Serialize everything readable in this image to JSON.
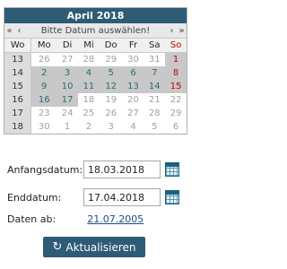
{
  "calendar": {
    "title": "April  2018",
    "nav": {
      "prev_year": "«",
      "prev_month": "‹",
      "message": "Bitte Datum auswählen!",
      "next_month": "›",
      "next_year": "»"
    },
    "weekday_headers": [
      "Wo",
      "Mo",
      "Di",
      "Mi",
      "Do",
      "Fr",
      "Sa",
      "So"
    ],
    "weeks": [
      {
        "wk": "13",
        "days": [
          "26",
          "27",
          "28",
          "29",
          "30",
          "31",
          "1"
        ]
      },
      {
        "wk": "14",
        "days": [
          "2",
          "3",
          "4",
          "5",
          "6",
          "7",
          "8"
        ]
      },
      {
        "wk": "15",
        "days": [
          "9",
          "10",
          "11",
          "12",
          "13",
          "14",
          "15"
        ]
      },
      {
        "wk": "16",
        "days": [
          "16",
          "17",
          "18",
          "19",
          "20",
          "21",
          "22"
        ]
      },
      {
        "wk": "17",
        "days": [
          "23",
          "24",
          "25",
          "26",
          "27",
          "28",
          "29"
        ]
      },
      {
        "wk": "18",
        "days": [
          "30",
          "1",
          "2",
          "3",
          "4",
          "5",
          "6"
        ]
      }
    ]
  },
  "form": {
    "start_label": "Anfangsdatum:",
    "start_value": "18.03.2018",
    "end_label": "Enddatum:",
    "end_value": "17.04.2018",
    "data_label": "Daten ab:",
    "data_link": "21.07.2005"
  },
  "refresh_button": {
    "label": "Aktualisieren",
    "icon": "refresh-icon"
  },
  "colors": {
    "header": "#2e5b76",
    "selected_range": "#c8c8c8",
    "sunday": "#c00000",
    "link": "#1a4f8a"
  }
}
